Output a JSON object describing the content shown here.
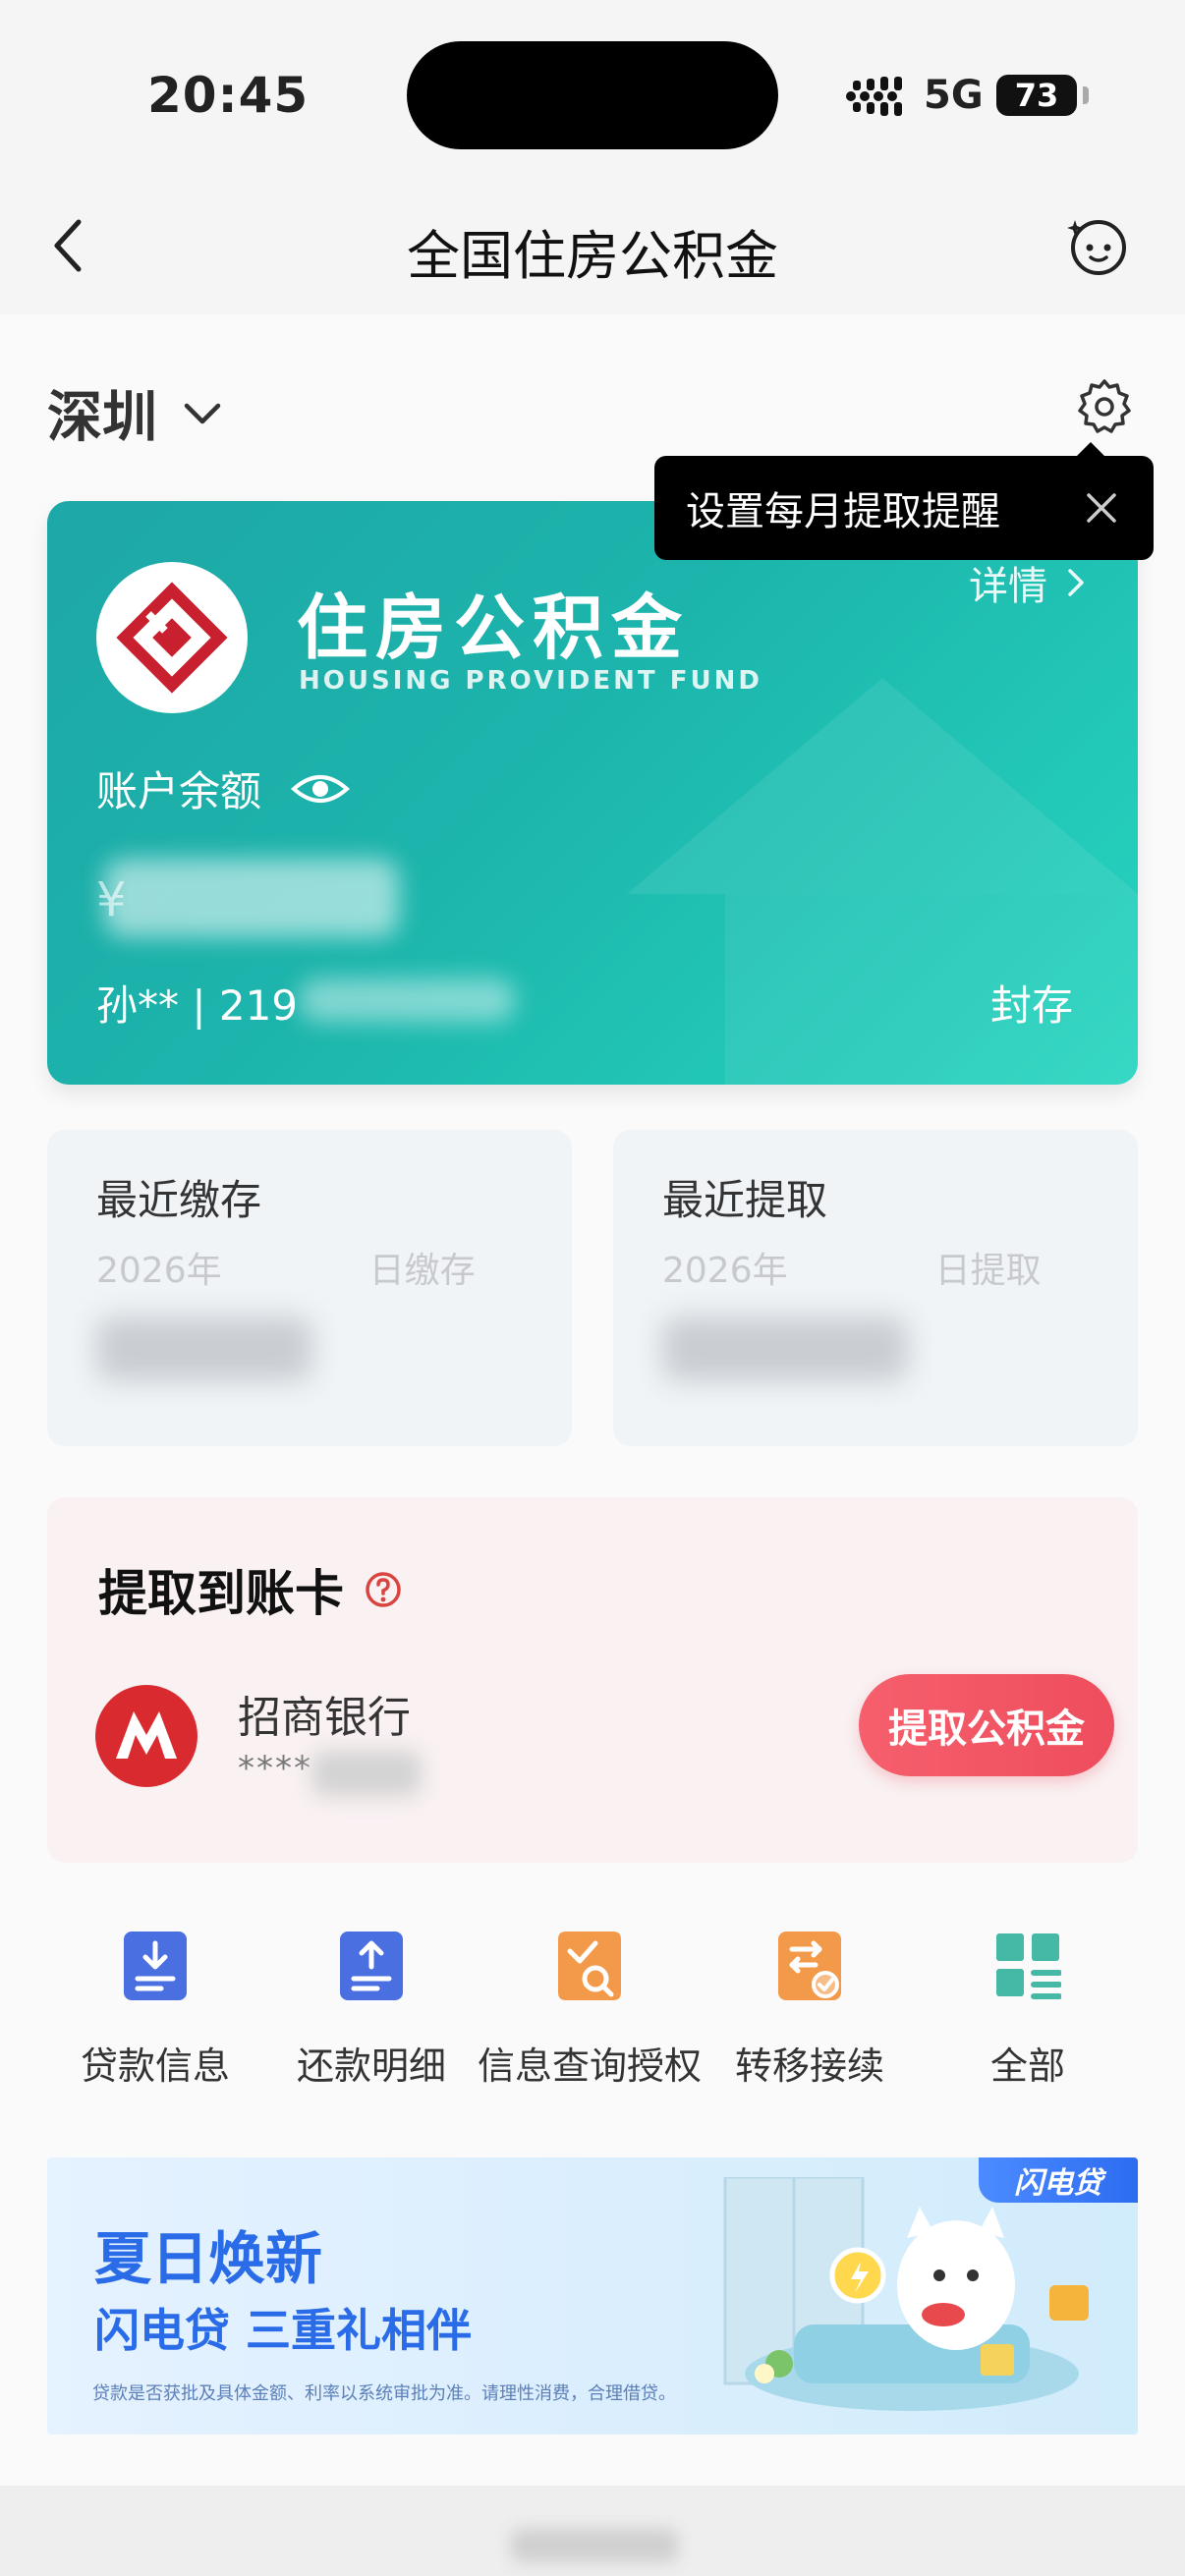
{
  "status_bar": {
    "time": "20:45",
    "network": "5G",
    "battery": "73"
  },
  "nav": {
    "title": "全国住房公积金"
  },
  "location": {
    "city": "深圳"
  },
  "tooltip": {
    "text": "设置每月提取提醒"
  },
  "fund_card": {
    "title": "住房公积金",
    "subtitle": "HOUSING PROVIDENT FUND",
    "detail_label": "详情",
    "balance_label": "账户余额",
    "balance_value": "¥",
    "owner": "孙** | 219",
    "status": "封存"
  },
  "recent_deposit": {
    "title": "最近缴存",
    "date_prefix": "2026年",
    "date_suffix": "日缴存"
  },
  "recent_withdraw": {
    "title": "最近提取",
    "date_prefix": "2026年",
    "date_suffix": "日提取"
  },
  "withdraw_section": {
    "title": "提取到账卡",
    "bank_name": "招商银行",
    "account_mask": "****",
    "button_label": "提取公积金"
  },
  "quick_actions": [
    {
      "label": "贷款信息",
      "icon": "download-doc-icon",
      "color": "#4a6fe0"
    },
    {
      "label": "还款明细",
      "icon": "upload-doc-icon",
      "color": "#4a6fe0"
    },
    {
      "label": "信息查询授权",
      "icon": "check-search-icon",
      "color": "#f39a4a"
    },
    {
      "label": "转移接续",
      "icon": "transfer-icon",
      "color": "#f39a4a"
    },
    {
      "label": "全部",
      "icon": "grid-icon",
      "color": "#46b9a6"
    }
  ],
  "banner": {
    "tag": "闪电贷",
    "title": "夏日焕新",
    "subtitle": "闪电贷 三重礼相伴",
    "note": "贷款是否获批及具体金额、利率以系统审批为准。请理性消费，合理借贷。"
  }
}
